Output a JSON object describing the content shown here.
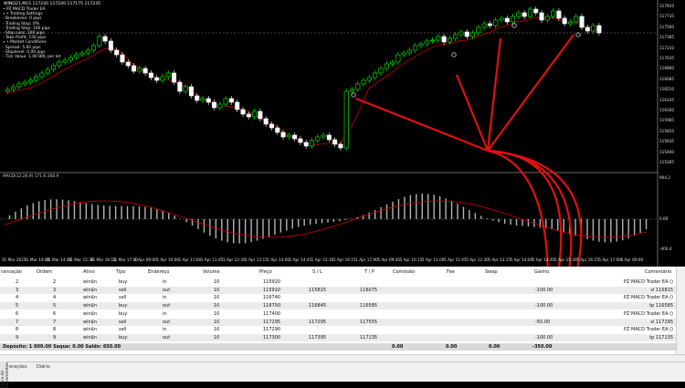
{
  "chart": {
    "title_line": "WINQ21,M15  117220 117220 117175 117235",
    "info_lines": [
      "• PZ MACD Trader EA",
      "» • Trading Settings",
      "- Breakeven: 0 pips",
      "- Trailing Stop: 0%",
      "- Trailing Step: 100 pips",
      "- Stop Loss: 100 pips",
      "- Take Profit: 150 pips",
      "» • Market Conditions",
      "- Spread: 5.00 pips",
      "- Stoplevel: 0.00 pips",
      "- Tick Value: 1.00 BRL per lot"
    ],
    "macd_label": "MACD(12,26,9) 171.6 268.9",
    "price_ticks": [
      "117910",
      "117735",
      "117560",
      "117385",
      "117210",
      "117035",
      "116860",
      "116685",
      "116510",
      "116335",
      "116160",
      "115985",
      "115810",
      "115635",
      "115460",
      "115285"
    ],
    "macd_ticks": [
      "904.2",
      "0.00",
      "-400.4"
    ],
    "time_ticks": [
      "31 Mar 2021",
      "31 Mar 14:00",
      "31 Mar 14:45",
      "31 Mar 15:30",
      "31 Mar 16:15",
      "31 Mar 17:00",
      "1 Apr 09:00",
      "1 Apr 10:00",
      "1 Apr 11:00",
      "1 Apr 11:45",
      "1 Apr 12:30",
      "1 Apr 13:15",
      "1 Apr 14:00",
      "1 Apr 14:45",
      "1 Apr 15:30",
      "1 Apr 16:15",
      "1 Apr 17:00",
      "5 Apr 09:45",
      "5 Apr 10:15",
      "5 Apr 11:00",
      "5 Apr 11:45",
      "5 Apr 12:30",
      "5 Apr 13:15",
      "5 Apr 14:00",
      "5 Apr 14:45",
      "5 Apr 15:30",
      "5 Apr 16:15",
      "5 Apr 17:00",
      "6 Apr 09:00"
    ],
    "colors": {
      "bull": "#00ff00",
      "bear": "#ffffff",
      "ma": "#cc0000",
      "arrow": "#e01010",
      "hist": "#b5b5b5"
    }
  },
  "table": {
    "headers": {
      "transacao": "ransação",
      "ordem": "Ordem",
      "ativo": "Ativo",
      "tipo": "Tipo",
      "endereco": "Endereço",
      "volume": "Volume",
      "preco": "Preço",
      "sl": "S / L",
      "tp": "T / P",
      "comissao": "Comissão",
      "fee": "Fee",
      "swap": "Swap",
      "ganho": "Ganho",
      "comentario": "Comentário"
    },
    "rows": [
      {
        "transacao": "2",
        "ordem": "2",
        "ativo": "win$n",
        "tipo": "buy",
        "endereco": "in",
        "volume": "10",
        "preco": "115920",
        "sl": "",
        "tp": "",
        "ganho": "",
        "comentario": "PZ MACD Trader EA ()"
      },
      {
        "transacao": "3",
        "ordem": "3",
        "ativo": "win$n",
        "tipo": "sell",
        "endereco": "out",
        "volume": "10",
        "preco": "115910",
        "sl": "115815",
        "tp": "116075",
        "ganho": "-100.00",
        "comentario": "sl 115815"
      },
      {
        "transacao": "4",
        "ordem": "4",
        "ativo": "win$n",
        "tipo": "sell",
        "endereco": "in",
        "volume": "10",
        "preco": "116740",
        "sl": "",
        "tp": "",
        "ganho": "",
        "comentario": "PZ MACD Trader EA ()"
      },
      {
        "transacao": "5",
        "ordem": "5",
        "ativo": "win$n",
        "tipo": "buy",
        "endereco": "out",
        "volume": "10",
        "preco": "116750",
        "sl": "116845",
        "tp": "116585",
        "ganho": "-100.00",
        "comentario": "tp 116585"
      },
      {
        "transacao": "6",
        "ordem": "6",
        "ativo": "win$n",
        "tipo": "buy",
        "endereco": "in",
        "volume": "10",
        "preco": "117400",
        "sl": "",
        "tp": "",
        "ganho": "",
        "comentario": "PZ MACD Trader EA ()"
      },
      {
        "transacao": "7",
        "ordem": "7",
        "ativo": "win$n",
        "tipo": "sell",
        "endereco": "out",
        "volume": "10",
        "preco": "117295",
        "sl": "117295",
        "tp": "117555",
        "ganho": "-50.00",
        "comentario": "sl 117295"
      },
      {
        "transacao": "8",
        "ordem": "8",
        "ativo": "win$n",
        "tipo": "sell",
        "endereco": "in",
        "volume": "10",
        "preco": "117290",
        "sl": "",
        "tp": "",
        "ganho": "",
        "comentario": "PZ MACD Trader EA ()"
      },
      {
        "transacao": "9",
        "ordem": "9",
        "ativo": "win$n",
        "tipo": "buy",
        "endereco": "out",
        "volume": "10",
        "preco": "117300",
        "sl": "117395",
        "tp": "117135",
        "ganho": "-100.00",
        "comentario": "tp 117135"
      }
    ],
    "summary": {
      "label": "Depósito: 1 000.00  Saque: 0.00  Saldo: 650.00",
      "comissao": "0.00",
      "fee": "0.00",
      "swap": "0.00",
      "ganho": "-350.00"
    }
  },
  "tabs": {
    "operacoes": "erações",
    "diario": "Diário",
    "toolbox": "Caixa de Ferramentas"
  }
}
